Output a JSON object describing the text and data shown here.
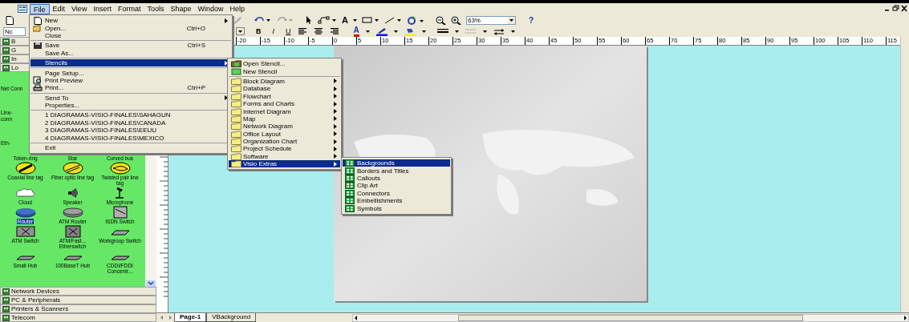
{
  "menu_bar": [
    {
      "label": "File",
      "selected": true
    },
    {
      "label": "Edit",
      "selected": false
    },
    {
      "label": "View",
      "selected": false
    },
    {
      "label": "Insert",
      "selected": false
    },
    {
      "label": "Format",
      "selected": false
    },
    {
      "label": "Tools",
      "selected": false
    },
    {
      "label": "Shape",
      "selected": false
    },
    {
      "label": "Window",
      "selected": false
    },
    {
      "label": "Help",
      "selected": false
    }
  ],
  "toolbar": {
    "font": "Nc",
    "text_tool": "A",
    "zoom": "63%",
    "help": "?",
    "format_buttons": [
      "B",
      "I",
      "U"
    ],
    "font_color": "A"
  },
  "file_menu": [
    {
      "kind": "item",
      "label": "New",
      "submenu": true,
      "selected": false
    },
    {
      "kind": "item",
      "label": "Open...",
      "shortcut": "Ctrl+O",
      "submenu": false,
      "selected": false
    },
    {
      "kind": "item",
      "label": "Close",
      "submenu": false,
      "selected": false
    },
    {
      "kind": "separator"
    },
    {
      "kind": "item",
      "label": "Save",
      "shortcut": "Ctrl+S",
      "submenu": false,
      "selected": false
    },
    {
      "kind": "item",
      "label": "Save As...",
      "submenu": false,
      "selected": false
    },
    {
      "kind": "separator"
    },
    {
      "kind": "item",
      "label": "Stencils",
      "submenu": true,
      "selected": true
    },
    {
      "kind": "separator"
    },
    {
      "kind": "item",
      "label": "Page Setup...",
      "submenu": false,
      "selected": false
    },
    {
      "kind": "item",
      "label": "Print Preview",
      "submenu": false,
      "selected": false
    },
    {
      "kind": "item",
      "label": "Print...",
      "shortcut": "Ctrl+P",
      "submenu": false,
      "selected": false
    },
    {
      "kind": "separator"
    },
    {
      "kind": "item",
      "label": "Send To",
      "submenu": true,
      "selected": false
    },
    {
      "kind": "item",
      "label": "Properties...",
      "submenu": false,
      "selected": false
    },
    {
      "kind": "separator"
    },
    {
      "kind": "item",
      "label": "1 DIAGRAMAS-VISIO-FINALES\\SAHAGUN",
      "submenu": false,
      "selected": false
    },
    {
      "kind": "item",
      "label": "2 DIAGRAMAS-VISIO-FINALES\\CANADA",
      "submenu": false,
      "selected": false
    },
    {
      "kind": "item",
      "label": "3 DIAGRAMAS-VISIO-FINALES\\EEUU",
      "submenu": false,
      "selected": false
    },
    {
      "kind": "item",
      "label": "4 DIAGRAMAS-VISIO-FINALES\\MEXICO",
      "submenu": false,
      "selected": false
    },
    {
      "kind": "separator"
    },
    {
      "kind": "item",
      "label": "Exit",
      "submenu": false,
      "selected": false
    }
  ],
  "stencils_menu": [
    {
      "kind": "command",
      "label": "Open Stencil...",
      "submenu": false,
      "selected": false
    },
    {
      "kind": "command",
      "label": "New Stencil",
      "submenu": false,
      "selected": false
    },
    {
      "kind": "separator"
    },
    {
      "kind": "folder",
      "label": "Block Diagram",
      "submenu": true,
      "selected": false
    },
    {
      "kind": "folder",
      "label": "Database",
      "submenu": true,
      "selected": false
    },
    {
      "kind": "folder",
      "label": "Flowchart",
      "submenu": true,
      "selected": false
    },
    {
      "kind": "folder",
      "label": "Forms and Charts",
      "submenu": true,
      "selected": false
    },
    {
      "kind": "folder",
      "label": "Internet Diagram",
      "submenu": true,
      "selected": false
    },
    {
      "kind": "folder",
      "label": "Map",
      "submenu": true,
      "selected": false
    },
    {
      "kind": "folder",
      "label": "Network Diagram",
      "submenu": true,
      "selected": false
    },
    {
      "kind": "folder",
      "label": "Office Layout",
      "submenu": true,
      "selected": false
    },
    {
      "kind": "folder",
      "label": "Organization Chart",
      "submenu": true,
      "selected": false
    },
    {
      "kind": "folder",
      "label": "Project Schedule",
      "submenu": true,
      "selected": false
    },
    {
      "kind": "folder",
      "label": "Software",
      "submenu": true,
      "selected": false
    },
    {
      "kind": "folder",
      "label": "Visio Extras",
      "submenu": true,
      "selected": true
    }
  ],
  "extras_menu": [
    {
      "label": "Backgrounds",
      "selected": true
    },
    {
      "label": "Borders and Titles",
      "selected": false
    },
    {
      "label": "Callouts",
      "selected": false
    },
    {
      "label": "Clip Art",
      "selected": false
    },
    {
      "label": "Connectors",
      "selected": false
    },
    {
      "label": "Embellishments",
      "selected": false
    },
    {
      "label": "Symbols",
      "selected": false
    }
  ],
  "stencil_headers_top": [
    "B",
    "G",
    "In",
    "Lo"
  ],
  "stencil": {
    "partial_labels": [
      "Net Conn",
      "Line- conn",
      "Eth-"
    ],
    "shapes": [
      {
        "kind": "label_only",
        "label": "Token-ring",
        "selected": false
      },
      {
        "kind": "label_only",
        "label": "Star",
        "selected": false
      },
      {
        "kind": "label_only",
        "label": "Curved bus",
        "selected": false
      },
      {
        "kind": "shape",
        "label": "Coaxial line tag",
        "selected": false
      },
      {
        "kind": "shape",
        "label": "Fiber optic line tag",
        "selected": false
      },
      {
        "kind": "shape",
        "label": "Twisted pair line tag",
        "selected": false
      },
      {
        "kind": "shape",
        "label": "Cloud",
        "selected": false
      },
      {
        "kind": "shape",
        "label": "Speaker",
        "selected": false
      },
      {
        "kind": "shape",
        "label": "Microphone",
        "selected": false
      },
      {
        "kind": "shape",
        "label": "Router",
        "selected": true
      },
      {
        "kind": "shape",
        "label": "ATM Router",
        "selected": false
      },
      {
        "kind": "shape",
        "label": "ISDN Switch",
        "selected": false
      },
      {
        "kind": "shape",
        "label": "ATM Switch",
        "selected": false
      },
      {
        "kind": "shape",
        "label": "ATM/Fast... Etherswitch",
        "selected": false
      },
      {
        "kind": "shape",
        "label": "Workgroup Switch",
        "selected": false
      },
      {
        "kind": "shape",
        "label": "Small Hub",
        "selected": false
      },
      {
        "kind": "shape",
        "label": "100BaseT Hub",
        "selected": false
      },
      {
        "kind": "shape",
        "label": "CDDI/FDDI Concentr...",
        "selected": false
      }
    ]
  },
  "stencil_headers_bottom": [
    "Network Devices",
    "PC & Peripherals",
    "Printers & Scanners",
    "Telecom"
  ],
  "ruler": {
    "labels": [
      "-20",
      "-15",
      "-10",
      "-5",
      "0",
      "5",
      "10",
      "15",
      "20",
      "25",
      "30",
      "35",
      "40",
      "45",
      "50",
      "55",
      "60",
      "65",
      "70",
      "75",
      "80",
      "85",
      "90",
      "95",
      "100",
      "105",
      "110",
      "115"
    ]
  },
  "page_tabs": [
    {
      "label": "Page-1",
      "selected": true
    },
    {
      "label": "VBackground",
      "selected": false
    }
  ]
}
